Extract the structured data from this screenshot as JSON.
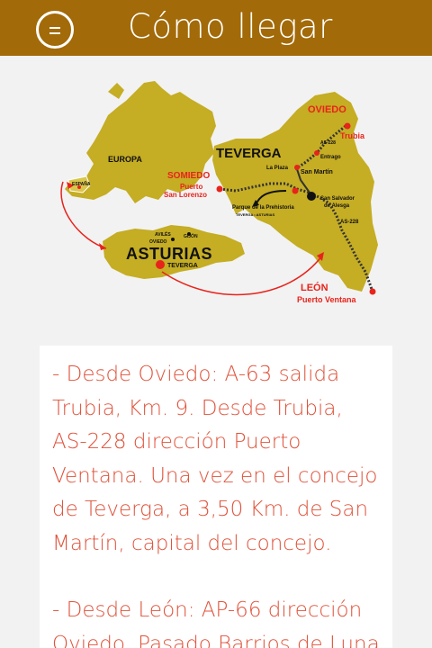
{
  "header": {
    "title": "Cómo llegar",
    "menu_icon": "menu-icon"
  },
  "map": {
    "europa": "EUROPA",
    "espana": "ESPAÑA",
    "teverga": "TEVERGA",
    "asturias": "ASTURIAS",
    "teverga_small": "TEVERGA",
    "oviedo": "OVIEDO",
    "trubia": "Trubia",
    "as228_top": "AS-228",
    "entrago": "Entrago",
    "la_plaza": "La Plaza",
    "san_martin": "San Martín",
    "somiedo": "SOMIEDO",
    "puerto_san_lorenzo_1": "Puerto",
    "puerto_san_lorenzo_2": "San Lorenzo",
    "parque": "Parque de la Prehistoria",
    "parque_sub": "TEVERGA • ASTURIAS",
    "san_salvador_1": "San Salvador",
    "san_salvador_2": "de Alesga",
    "as228": "AS-228",
    "aviles": "AVILÉS",
    "gijon": "GIJÓN",
    "oviedo_small": "OVIEDO",
    "leon": "LEÓN",
    "puerto_ventana": "Puerto Ventana",
    "colors": {
      "region": "#c5ad24",
      "route": "#e8231b",
      "accent": "#a26a08"
    }
  },
  "directions": {
    "p1": "- Desde Oviedo: A-63 salida Trubia, Km. 9. Desde Trubia, AS-228 dirección Puerto Ventana. Una vez en el concejo de Teverga, a 3,50 Km. de San Martín, capital del concejo.",
    "p2": "- Desde León: AP-66 dirección Oviedo. Pasado Barrios de Luna"
  }
}
